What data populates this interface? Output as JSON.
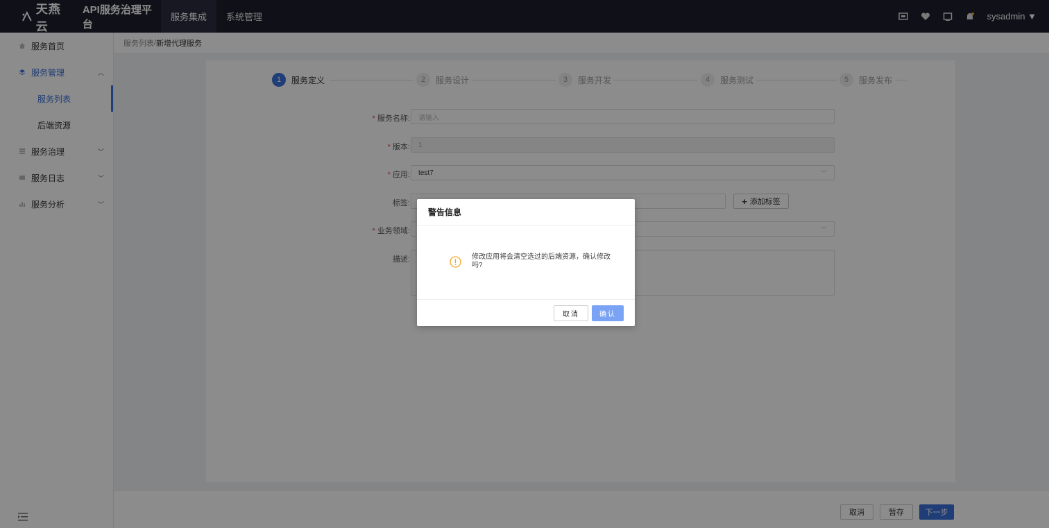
{
  "header": {
    "brand": "天燕云",
    "platform": "API服务治理平台",
    "nav": [
      "服务集成",
      "系统管理"
    ],
    "active_nav": "服务集成",
    "user": "sysadmin"
  },
  "sidebar": {
    "items": [
      {
        "label": "服务首页"
      },
      {
        "label": "服务管理",
        "expanded": true,
        "children": [
          {
            "label": "服务列表",
            "active": true
          },
          {
            "label": "后端资源"
          }
        ]
      },
      {
        "label": "服务治理"
      },
      {
        "label": "服务日志"
      },
      {
        "label": "服务分析"
      }
    ]
  },
  "breadcrumb": {
    "parent": "服务列表",
    "separator": " / ",
    "current": "新增代理服务"
  },
  "steps": [
    {
      "num": "1",
      "label": "服务定义",
      "active": true
    },
    {
      "num": "2",
      "label": "服务设计"
    },
    {
      "num": "3",
      "label": "服务开发"
    },
    {
      "num": "4",
      "label": "服务测试"
    },
    {
      "num": "5",
      "label": "服务发布"
    }
  ],
  "form": {
    "name": {
      "label": "服务名称:",
      "placeholder": "请输入"
    },
    "version": {
      "label": "版本:",
      "value": "1"
    },
    "app": {
      "label": "应用:",
      "value": "test7"
    },
    "tags": {
      "label": "标签:",
      "button": "添加标签"
    },
    "domain": {
      "label": "业务领域:"
    },
    "desc": {
      "label": "描述:"
    }
  },
  "footer": {
    "cancel": "取消",
    "save": "暂存",
    "next": "下一步"
  },
  "modal": {
    "title": "警告信息",
    "message": "修改应用将会清空选过的后端资源，确认修改吗?",
    "cancel": "取消",
    "confirm": "确认"
  },
  "colors": {
    "primary": "#3a6fd8",
    "topbar": "#1e1e2d",
    "warning": "#f5a623",
    "required": "#e0423b"
  }
}
